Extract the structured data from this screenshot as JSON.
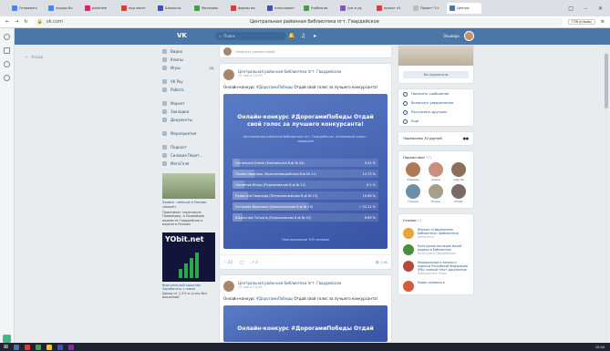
{
  "browser": {
    "tabs": [
      {
        "label": "Отправить",
        "color": "#4285f4",
        "active": false
      },
      {
        "label": "эндорс.бл",
        "color": "#4285f4",
        "active": false
      },
      {
        "label": "pokehere",
        "color": "#e91e63",
        "active": false
      },
      {
        "label": "под пакет",
        "color": "#e53935",
        "active": false
      },
      {
        "label": "Школьны",
        "color": "#3f51b5",
        "active": false
      },
      {
        "label": "Материал",
        "color": "#43a047",
        "active": false
      },
      {
        "label": "формы мо",
        "color": "#e53935",
        "active": false
      },
      {
        "label": "план-мероп",
        "color": "#3f51b5",
        "active": false
      },
      {
        "label": "Учебно-во",
        "color": "#43a047",
        "active": false
      },
      {
        "label": "(уж в уд.",
        "color": "#7e57c2",
        "active": false
      },
      {
        "label": "проект к5",
        "color": "#e53935",
        "active": false
      },
      {
        "label": "Проект \"Ст",
        "color": "#bdbdbd",
        "active": false
      },
      {
        "label": "Центра",
        "color": "#4a76a8",
        "active": true
      }
    ],
    "address": {
      "url": "vk.com",
      "page_title": "Центральная районная библиотека пгт. Гвардейское",
      "yandex_button": "ГЭК отзывы"
    },
    "window_controls": [
      "□",
      "–",
      "✕"
    ]
  },
  "vk": {
    "logo": "VK",
    "search_placeholder": "Поиск",
    "user_name": "Эльвира",
    "back_label": "Назад",
    "menu": [
      {
        "label": "Видео",
        "count": "",
        "gap_after": false
      },
      {
        "label": "Клипы",
        "count": "",
        "gap_after": false
      },
      {
        "label": "Игры",
        "count": "28",
        "gap_after": true
      },
      {
        "label": "VK Pay",
        "count": "",
        "gap_after": false
      },
      {
        "label": "Работа",
        "count": "",
        "gap_after": true
      },
      {
        "label": "Маркет",
        "count": "",
        "gap_after": false
      },
      {
        "label": "Закладки",
        "count": "",
        "gap_after": false
      },
      {
        "label": "Документы",
        "count": "",
        "gap_after": true
      },
      {
        "label": "Мероприятия",
        "count": "",
        "gap_after": true
      },
      {
        "label": "Подкаст",
        "count": "",
        "gap_after": false
      },
      {
        "label": "Силовая Перет...",
        "count": "",
        "gap_after": false
      },
      {
        "label": "МегаГеля",
        "count": "",
        "gap_after": false
      }
    ],
    "ad": {
      "title": "Заявка - меньше в Рекома",
      "subtitle": "самолёт",
      "text": "Принимает заказчиков Провайдер, и Провайдер ведомств Гвардейского охране в Рекома"
    },
    "yobit": {
      "brand": "YObit.net",
      "title": "Виртуальный кошелёк Заработать с нами!",
      "text": "Доход от 1,2% в сутки без вложений"
    }
  },
  "feed": {
    "comment_placeholder": "Написать комментарий",
    "post1": {
      "author": "Центральная районная библиотека пгт. Гвардейское",
      "time": "12 апр в 10:33",
      "text_before": "Онлайн-конкурс ",
      "hashtag": "#ДорогамиПобеды",
      "text_after": " Отдай свой голос за лучшего конкурсанта!",
      "poll_title": "Онлайн-конкурс #ДорогамиПобеды Отдай свой голос за лучшего конкурсанта!",
      "poll_subtitle": "Центральная районная библиотека пгт. Гвардейское. Анонимный опрос · завершён",
      "options": [
        {
          "label": "Останкина Елена (Клепинская б-ф № 28)",
          "percent": 5.01,
          "display": "5.01 %",
          "voted": false
        },
        {
          "label": "Пашко Надежда (Красногвардейская б-ф № 11)",
          "percent": 14.75,
          "display": "14.75 %",
          "voted": false
        },
        {
          "label": "Литвинов Игорь (Родниковская б-ф № 12)",
          "percent": 8.2,
          "display": "8.2 %",
          "voted": false
        },
        {
          "label": "Родыгина Надежда (Петропавловская б-ф № 13)",
          "percent": 10.66,
          "display": "10.66 %",
          "voted": false
        },
        {
          "label": "Остапова Вероника (Школьненская б-ф № 15)",
          "percent": 52.11,
          "display": "✓  52.11 %",
          "voted": true
        },
        {
          "label": "Шкильнюк Татьяна (Родниковская б-ф № 42)",
          "percent": 6.89,
          "display": "6.89 %",
          "voted": false
        }
      ],
      "votes": "Проголосовали 305 человек",
      "likes": "23",
      "comments": "",
      "shares": "3",
      "views": "1.6K"
    },
    "post2": {
      "author": "Центральная районная библиотека пгт. Гвардейское",
      "time": "12 апр в 10:24",
      "text_before": "Онлайн-конкурс ",
      "hashtag": "#ДорогамиПобеды",
      "text_after": " Отдай свой голос за лучшего конкурсанта!",
      "poll_title": "Онлайн-конкурс #ДорогамиПобеды Отдай"
    }
  },
  "right": {
    "subscribed_label": "Вы подписаны",
    "actions": [
      "Написать сообщение",
      "Включить уведомления",
      "Рассказать друзьям",
      "Ещё"
    ],
    "friends_subscribed": "Подписаны 30 друзей",
    "subscribers_label": "Подписчики",
    "subscribers_count": "171",
    "subscribers": [
      {
        "name": "Эльвира",
        "color": "#b07a55"
      },
      {
        "name": "Алёна",
        "color": "#c98e7d"
      },
      {
        "name": "Сергей",
        "color": "#8d6e5a"
      },
      {
        "name": "Галина",
        "color": "#6d8fa5"
      },
      {
        "name": "Елена",
        "color": "#a59f8a"
      },
      {
        "name": "Юлия",
        "color": "#7a6a65"
      }
    ],
    "links_label": "Ссылки",
    "links_count": "11",
    "links": [
      {
        "title": "Журнал «Современная библиотека» (Библиотека)",
        "sub": "bibliomir.ru",
        "color": "#e8a33d"
      },
      {
        "title": "Культурное наследие малой родины в Библиотеке",
        "sub": "Культура в Гвардейском",
        "color": "#4a8f3b"
      },
      {
        "title": "Федеральные и законы и кодексы Российской Федерации (РФ): полный текст документов",
        "sub": "Консультант Плюс",
        "color": "#b54a3a"
      },
      {
        "title": "Право человека в",
        "sub": "",
        "color": "#d35a3a"
      }
    ]
  },
  "taskbar": {
    "time": "10:44",
    "icons": [
      "#4a76a8",
      "#e53935",
      "#43a047",
      "#fbc02d",
      "#3f51b5",
      "#8e24aa"
    ]
  }
}
